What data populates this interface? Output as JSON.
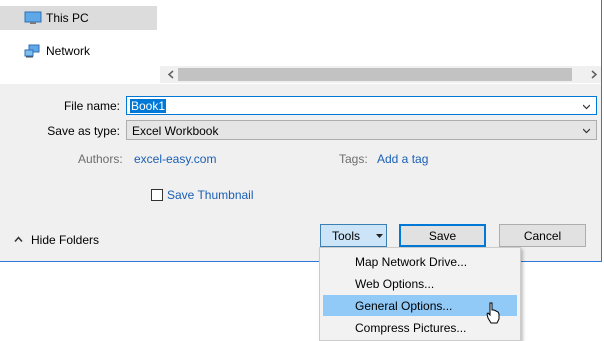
{
  "nav": {
    "items": [
      {
        "label": "This PC",
        "icon": "monitor-icon",
        "selected": true
      },
      {
        "label": "Network",
        "icon": "network-icon",
        "selected": false
      }
    ]
  },
  "form": {
    "file_name_label": "File name:",
    "file_name_value": "Book1",
    "save_as_type_label": "Save as type:",
    "save_as_type_value": "Excel Workbook",
    "authors_label": "Authors:",
    "authors_value": "excel-easy.com",
    "tags_label": "Tags:",
    "tags_value": "Add a tag",
    "save_thumbnail_label": "Save Thumbnail",
    "save_thumbnail_checked": false
  },
  "footer": {
    "hide_folders_label": "Hide Folders",
    "tools_label": "Tools",
    "save_label": "Save",
    "cancel_label": "Cancel"
  },
  "tools_menu": {
    "items": [
      {
        "label": "Map Network Drive..."
      },
      {
        "label": "Web Options..."
      },
      {
        "label": "General Options...",
        "highlighted": true
      },
      {
        "label": "Compress Pictures..."
      }
    ]
  },
  "colors": {
    "accent": "#0078d7",
    "link": "#1a5fb4",
    "menu_highlight": "#91c9f7"
  }
}
